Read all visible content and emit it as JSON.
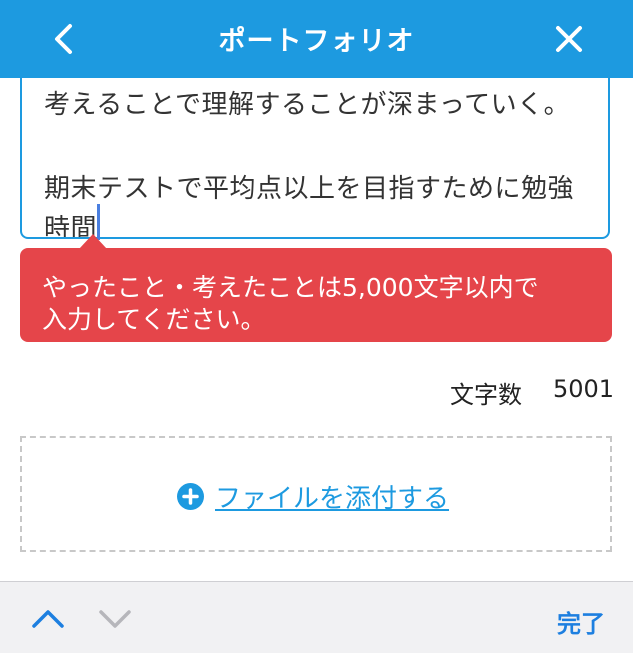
{
  "header": {
    "title": "ポートフォリオ",
    "back_icon": "chevron-left-icon",
    "close_icon": "close-icon",
    "color": "#1d9ae0"
  },
  "textarea": {
    "lines": [
      "考えることで理解することが深まっていく。",
      "",
      "期末テストで平均点以上を目指すために勉強",
      "時間"
    ]
  },
  "error": {
    "message_line1": "やったこと・考えたことは5,000文字以内で",
    "message_line2": "入力してください。",
    "color": "#e5454a"
  },
  "char_count": {
    "label": "文字数",
    "value": "5001"
  },
  "attach": {
    "label": "ファイルを添付する",
    "icon": "plus-circle-icon"
  },
  "keyboard_bar": {
    "up_icon": "chevron-up-icon",
    "down_icon": "chevron-down-icon",
    "done_label": "完了"
  }
}
